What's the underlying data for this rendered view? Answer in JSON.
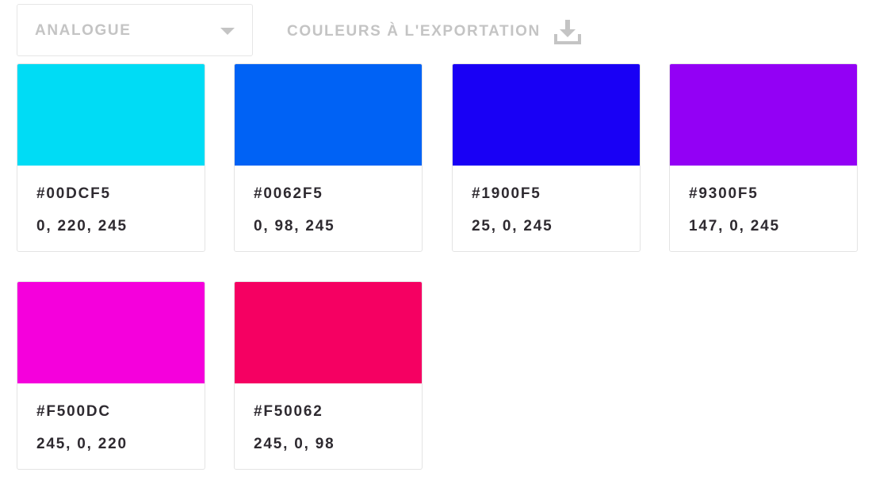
{
  "toolbar": {
    "scheme_select": {
      "selected": "ANALOGUE",
      "caret_icon": "caret-down-icon"
    },
    "export": {
      "label": "COULEURS À L'EXPORTATION",
      "icon": "download-icon"
    },
    "muted_color": "#c4c4c4"
  },
  "palette": [
    {
      "hex": "#00DCF5",
      "rgb": "0, 220, 245",
      "swatch": "#00DCF5"
    },
    {
      "hex": "#0062F5",
      "rgb": "0, 98, 245",
      "swatch": "#0062F5"
    },
    {
      "hex": "#1900F5",
      "rgb": "25, 0, 245",
      "swatch": "#1900F5"
    },
    {
      "hex": "#9300F5",
      "rgb": "147, 0, 245",
      "swatch": "#9300F5"
    },
    {
      "hex": "#F500DC",
      "rgb": "245, 0, 220",
      "swatch": "#F500DC"
    },
    {
      "hex": "#F50062",
      "rgb": "245, 0, 98",
      "swatch": "#F50062"
    }
  ]
}
